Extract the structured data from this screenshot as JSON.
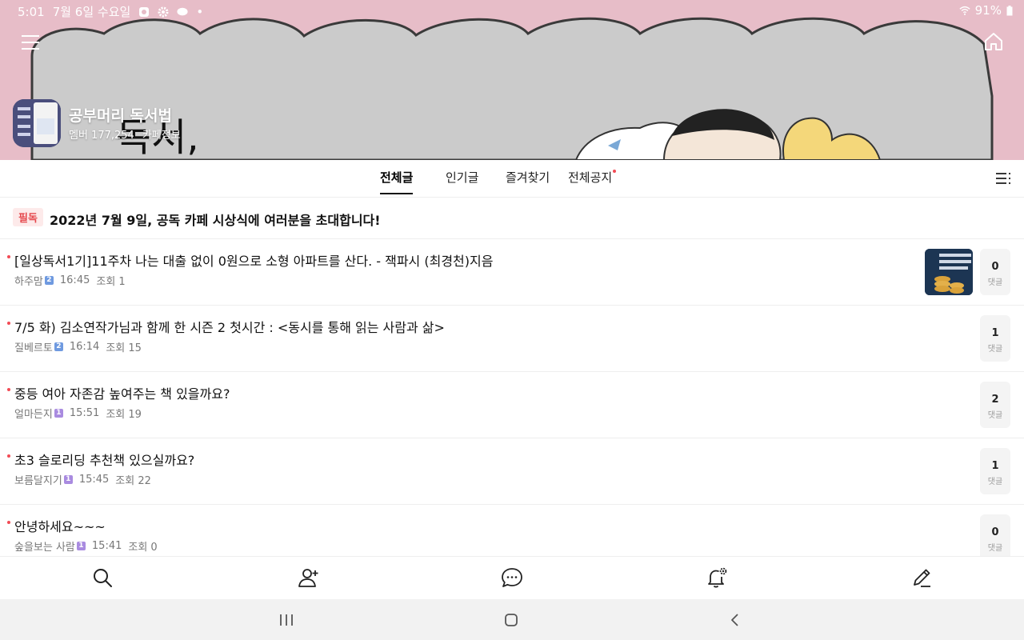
{
  "status_bar": {
    "time": "5:01",
    "date": "7월 6일 수요일",
    "battery": "91%"
  },
  "cafe": {
    "title": "공부머리 독서법",
    "members": "멤버 177,254",
    "info_label": "카페정보",
    "banner_text": "독서,"
  },
  "tabs": [
    {
      "label": "전체글",
      "active": true
    },
    {
      "label": "인기글",
      "active": false
    },
    {
      "label": "즐겨찾기",
      "active": false
    },
    {
      "label": "전체공지",
      "active": false,
      "has_dot": true
    }
  ],
  "notice": {
    "badge": "필독",
    "title": "2022년 7월 9일, 공독 카페 시상식에 여러분을 초대합니다!"
  },
  "posts": [
    {
      "title": "[일상독서1기]11주차 나는 대출 없이 0원으로 소형 아파트를 산다. - 잭파시 (최경천)지음",
      "author": "하주맘",
      "level": "2",
      "time": "16:45",
      "views": "조회 1",
      "comments": "0",
      "has_thumb": true
    },
    {
      "title": "7/5 화) 김소연작가님과 함께 한 시즌 2 첫시간 : <동시를 통해 읽는 사람과 삶>",
      "author": "질베르토",
      "level": "2",
      "time": "16:14",
      "views": "조회 15",
      "comments": "1",
      "has_thumb": false
    },
    {
      "title": "중등 여아 자존감 높여주는 책 있을까요?",
      "author": "얼마든지",
      "level": "1",
      "time": "15:51",
      "views": "조회 19",
      "comments": "2",
      "has_thumb": false
    },
    {
      "title": "초3 슬로리딩 추천책 있으실까요?",
      "author": "보름달지기",
      "level": "1",
      "time": "15:45",
      "views": "조회 22",
      "comments": "1",
      "has_thumb": false
    },
    {
      "title": "안녕하세요~~~",
      "author": "숲을보는 사람",
      "level": "1",
      "time": "15:41",
      "views": "조회 0",
      "comments": "0",
      "has_thumb": false
    }
  ],
  "comment_label": "댓글",
  "colors": {
    "accent_dot": "#f24b55",
    "level_1": "#a98be0",
    "level_2": "#6f9ae0",
    "banner_pink": "#e6bcc7"
  },
  "icons": {
    "bottom_nav": [
      "search-icon",
      "add-friend-icon",
      "chat-icon",
      "notification-settings-icon",
      "write-icon"
    ]
  }
}
